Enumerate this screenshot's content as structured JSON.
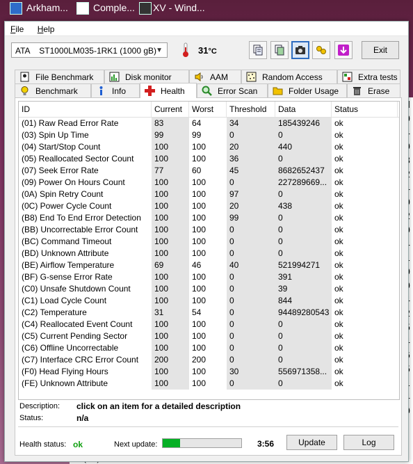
{
  "taskbar": {
    "items": [
      "Arkham...",
      "Comple...",
      "XV - Wind..."
    ]
  },
  "menu": {
    "file": "File",
    "help": "Help"
  },
  "toolbar": {
    "drive": "ATA    ST1000LM035-1RK1 (1000 gB)",
    "temperature": "31",
    "temp_unit": "°C",
    "exit_label": "Exit"
  },
  "tabs": {
    "row1": [
      "File Benchmark",
      "Disk monitor",
      "AAM",
      "Random Access",
      "Extra tests"
    ],
    "row2": [
      "Benchmark",
      "Info",
      "Health",
      "Error Scan",
      "Folder Usage",
      "Erase"
    ],
    "active": "Health"
  },
  "table": {
    "columns": [
      "ID",
      "Current",
      "Worst",
      "Threshold",
      "Data",
      "Status"
    ],
    "rows": [
      [
        "(01) Raw Read Error Rate",
        "83",
        "64",
        "34",
        "185439246",
        "ok"
      ],
      [
        "(03) Spin Up Time",
        "99",
        "99",
        "0",
        "0",
        "ok"
      ],
      [
        "(04) Start/Stop Count",
        "100",
        "100",
        "20",
        "440",
        "ok"
      ],
      [
        "(05) Reallocated Sector Count",
        "100",
        "100",
        "36",
        "0",
        "ok"
      ],
      [
        "(07) Seek Error Rate",
        "77",
        "60",
        "45",
        "8682652437",
        "ok"
      ],
      [
        "(09) Power On Hours Count",
        "100",
        "100",
        "0",
        "227289669...",
        "ok"
      ],
      [
        "(0A) Spin Retry Count",
        "100",
        "100",
        "97",
        "0",
        "ok"
      ],
      [
        "(0C) Power Cycle Count",
        "100",
        "100",
        "20",
        "438",
        "ok"
      ],
      [
        "(B8) End To End Error Detection",
        "100",
        "100",
        "99",
        "0",
        "ok"
      ],
      [
        "(BB) Uncorrectable Error Count",
        "100",
        "100",
        "0",
        "0",
        "ok"
      ],
      [
        "(BC) Command Timeout",
        "100",
        "100",
        "0",
        "0",
        "ok"
      ],
      [
        "(BD) Unknown Attribute",
        "100",
        "100",
        "0",
        "0",
        "ok"
      ],
      [
        "(BE) Airflow Temperature",
        "69",
        "46",
        "40",
        "521994271",
        "ok"
      ],
      [
        "(BF) G-sense Error Rate",
        "100",
        "100",
        "0",
        "391",
        "ok"
      ],
      [
        "(C0) Unsafe Shutdown Count",
        "100",
        "100",
        "0",
        "39",
        "ok"
      ],
      [
        "(C1) Load Cycle Count",
        "100",
        "100",
        "0",
        "844",
        "ok"
      ],
      [
        "(C2) Temperature",
        "31",
        "54",
        "0",
        "94489280543",
        "ok"
      ],
      [
        "(C4) Reallocated Event Count",
        "100",
        "100",
        "0",
        "0",
        "ok"
      ],
      [
        "(C5) Current Pending Sector",
        "100",
        "100",
        "0",
        "0",
        "ok"
      ],
      [
        "(C6) Offline Uncorrectable",
        "100",
        "100",
        "0",
        "0",
        "ok"
      ],
      [
        "(C7) Interface CRC Error Count",
        "200",
        "200",
        "0",
        "0",
        "ok"
      ],
      [
        "(F0) Head Flying Hours",
        "100",
        "100",
        "30",
        "556971358...",
        "ok"
      ],
      [
        "(FE) Unknown Attribute",
        "100",
        "100",
        "0",
        "0",
        "ok"
      ]
    ]
  },
  "description": {
    "label": "Description:",
    "text": "click on an item for a detailed description",
    "status_label": "Status:",
    "status_value": "n/a"
  },
  "footer": {
    "health_label": "Health status:",
    "health_value": "ok",
    "next_update_label": "Next update:",
    "progress_fraction": 0.22,
    "timer": "3:56",
    "update_label": "Update",
    "log_label": "Log"
  },
  "background": {
    "side_chars": [
      "d",
      "",
      "",
      "",
      "0",
      "4",
      "0",
      "8",
      "2",
      "4",
      "0",
      "2",
      "0",
      "4",
      "1",
      "0",
      "0",
      "4",
      "2",
      "5",
      "4",
      "6",
      "5",
      "1",
      "",
      "4",
      "0"
    ],
    "strip_texts": [
      "(C7) Interface CRC Error Count",
      "200",
      "200",
      "0"
    ]
  },
  "colors": {
    "health_ok": "#10a010",
    "progress": "#06b025",
    "active_tab_accent": "#d21f1f"
  }
}
